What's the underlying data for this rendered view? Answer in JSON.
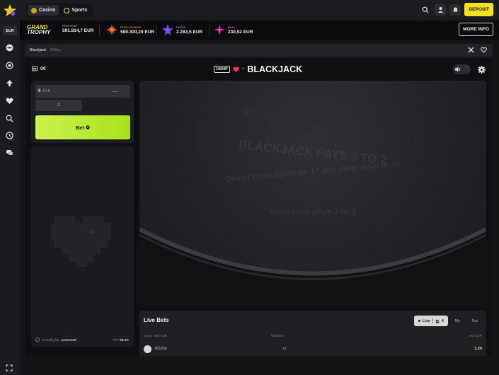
{
  "topbar": {
    "tabs": [
      {
        "label": "Casino",
        "icon": "chip-icon",
        "active": true
      },
      {
        "label": "Sports",
        "icon": "ball-icon",
        "active": false
      }
    ],
    "deposit_label": "DEPOSIT"
  },
  "promo": {
    "trophy_line1": "GRAND",
    "trophy_line2": "TROPHY",
    "jackpots": [
      {
        "label": "Prize Pool",
        "value": "591.814,7",
        "unit": "EUR",
        "color": "#ffffff"
      },
      {
        "label": "Prime Network",
        "value": "589.300,29",
        "unit": "EUR",
        "color": "#ff5a1f"
      },
      {
        "label": "Mobile",
        "value": "2.283,5",
        "unit": "EUR",
        "color": "#7a4dff"
      },
      {
        "label": "Hero",
        "value": "230,92",
        "unit": "EUR",
        "color": "#ff3ec8"
      }
    ],
    "more_info_label": "MORE INFO"
  },
  "sidebar": {
    "currency": "EUR",
    "icons": [
      "minus-circle-icon",
      "spiral-icon",
      "upload-arrow-icon",
      "heart-icon",
      "search-icon",
      "clock-icon",
      "chat-icon"
    ]
  },
  "breadcrumb": {
    "game": "Blackjack",
    "provider": "100hp"
  },
  "game": {
    "balance": "0",
    "balance_unit": "€",
    "provider_badge": "100HP",
    "separator": "×",
    "title": "BLACKJACK",
    "bet_amount": "0",
    "bet_currency": "10 €",
    "amount_dash": "—",
    "half_label": "/2",
    "bet_label": "Bet",
    "fair_label": "Provably fair",
    "fair_value": "protected",
    "rtp_label": "RTP",
    "rtp_value": "99.5%",
    "felt_line1": "BLACKJACK PAYS 3 TO 2",
    "felt_line2": "Dealer must stand on 17 and must draw to 16",
    "felt_line3": "Insurance pays 2 to 1"
  },
  "live_bets": {
    "title": "Live Bets",
    "tabs": [
      {
        "label": "Live",
        "count": "4",
        "active": true
      },
      {
        "label": "My",
        "active": false
      },
      {
        "label": "Top",
        "active": false
      }
    ],
    "headers": [
      "Name / Bet EUR",
      "Multiplier",
      "Win EUR"
    ],
    "rows": [
      {
        "name": "831259",
        "multiplier": "x1",
        "win": "1.29"
      }
    ]
  },
  "colors": {
    "accent_yellow": "#f4e11b",
    "bet_green": "#b6eb2b",
    "background": "#141517"
  }
}
